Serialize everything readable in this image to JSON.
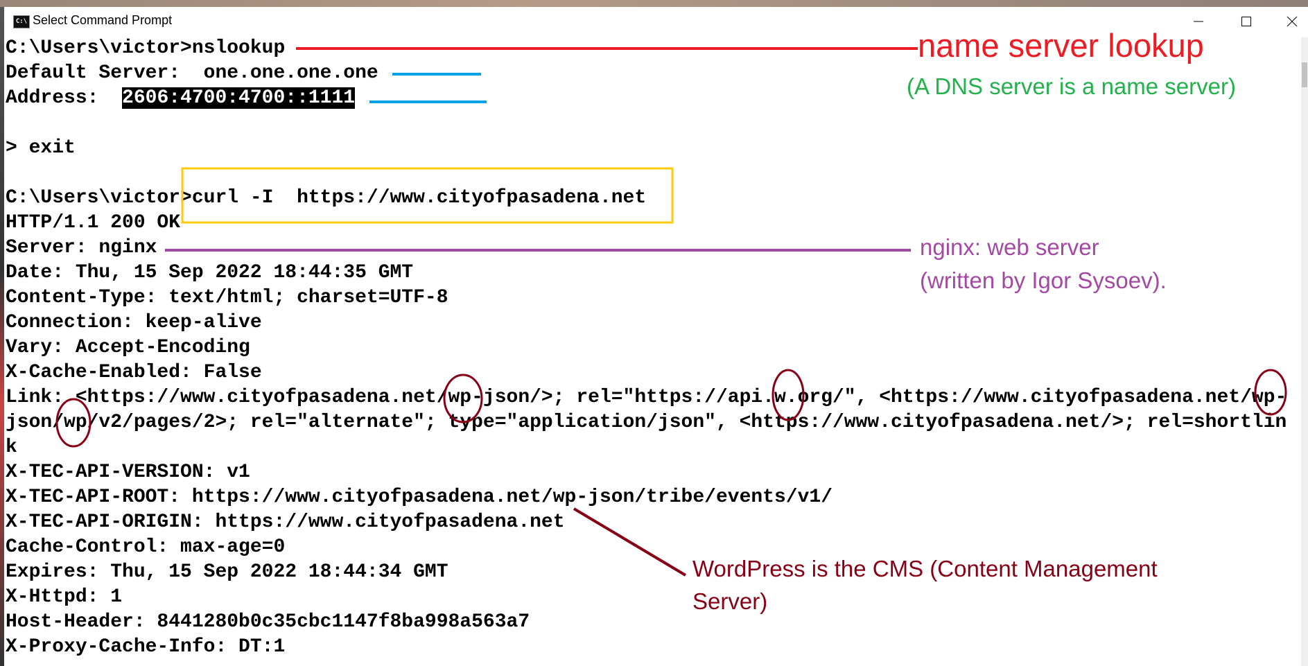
{
  "window": {
    "title": "Select Command Prompt",
    "icon": "cmd-icon",
    "controls": [
      "minimize-icon",
      "maximize-icon",
      "close-icon"
    ]
  },
  "terminal": {
    "lines": [
      "C:\\Users\\victor>nslookup",
      "Default Server:  one.one.one.one",
      "",
      "",
      "> exit",
      "",
      "C:\\Users\\victor>curl -I  https://www.cityofpasadena.net",
      "HTTP/1.1 200 OK",
      "Server: nginx",
      "Date: Thu, 15 Sep 2022 18:44:35 GMT",
      "Content-Type: text/html; charset=UTF-8",
      "Connection: keep-alive",
      "Vary: Accept-Encoding",
      "X-Cache-Enabled: False",
      "Link: <https://www.cityofpasadena.net/wp-json/>; rel=\"https://api.w.org/\", <https://www.cityofpasadena.net/wp-",
      "json/wp/v2/pages/2>; rel=\"alternate\"; type=\"application/json\", <https://www.cityofpasadena.net/>; rel=shortlin",
      "k",
      "X-TEC-API-VERSION: v1",
      "X-TEC-API-ROOT: https://www.cityofpasadena.net/wp-json/tribe/events/v1/",
      "X-TEC-API-ORIGIN: https://www.cityofpasadena.net",
      "Cache-Control: max-age=0",
      "Expires: Thu, 15 Sep 2022 18:44:34 GMT",
      "X-Httpd: 1",
      "Host-Header: 8441280b0c35cbc1147f8ba998a563a7",
      "X-Proxy-Cache-Info: DT:1"
    ],
    "address_label": "Address:  ",
    "address_value": "2606:4700:4700::1111"
  },
  "annotations": {
    "nslookup": {
      "text": "name server lookup",
      "color": "#ed1c24"
    },
    "dns": {
      "text": "(A DNS server is a name server)",
      "color": "#22b14c"
    },
    "nginx_line1": "nginx:  web server",
    "nginx_line2": "(written by Igor Sysoev).",
    "nginx_color": "#a349a4",
    "wordpress_line1": "WordPress is the CMS (Content Management",
    "wordpress_line2": "Server)",
    "wordpress_color": "#880015",
    "blue_color": "#00a2e8",
    "yellow_color": "#ffc90e"
  }
}
